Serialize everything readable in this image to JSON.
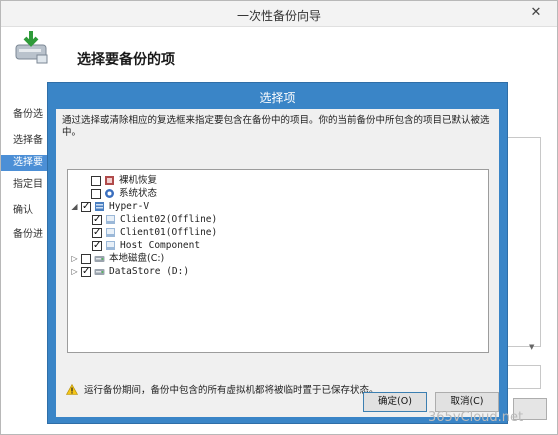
{
  "wizard": {
    "title": "一次性备份向导",
    "heading": "选择要备份的项",
    "close_glyph": "✕",
    "nav": [
      "备份选",
      "选择备",
      "选择要",
      "指定目",
      "确认",
      "备份进"
    ]
  },
  "dialog": {
    "title": "选择项",
    "instructions": "通过选择或清除相应的复选框来指定要包含在备份中的项目。你的当前备份中所包含的项目已默认被选中。",
    "tree": [
      {
        "label": "裸机恢复",
        "checked": false,
        "icon": "bare-metal-icon"
      },
      {
        "label": "系统状态",
        "checked": false,
        "icon": "system-state-icon"
      },
      {
        "label": "Hyper-V",
        "checked": true,
        "icon": "hyperv-icon"
      },
      {
        "label": "Client02(Offline)",
        "checked": true,
        "icon": "vm-icon"
      },
      {
        "label": "Client01(Offline)",
        "checked": true,
        "icon": "vm-icon"
      },
      {
        "label": "Host Component",
        "checked": true,
        "icon": "vm-icon"
      },
      {
        "label": "本地磁盘(C:)",
        "checked": false,
        "icon": "disk-icon"
      },
      {
        "label": "DataStore (D:)",
        "checked": true,
        "icon": "disk-icon"
      }
    ],
    "warning": "运行备份期间，备份中包含的所有虚拟机都将被临时置于已保存状态。",
    "ok_label": "确定(O)",
    "cancel_label": "取消(C)"
  },
  "watermark": "365vCloud.net"
}
